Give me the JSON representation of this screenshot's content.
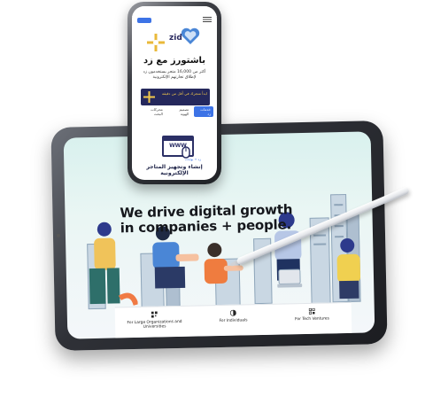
{
  "tablet": {
    "headline": [
      "We drive digital growth",
      "in companies + people."
    ],
    "cards": [
      {
        "icon": "qr-icon",
        "label": "For Large Organizations and Universities"
      },
      {
        "icon": "half-circle-icon",
        "label": "For Individuals"
      },
      {
        "icon": "grid-icon",
        "label": "For Tech Ventures"
      }
    ]
  },
  "phone": {
    "brand": "zid",
    "title": "باشتورز مع زد",
    "subtitle": "أكثر من 16,000 متجر يستخدمون زد لإطلاق تجارتهم الإلكترونية",
    "banner_text": "ابدأ متجرك في أقل من دقيقة",
    "tabs": [
      "خدمات زد",
      "تصميم الهوية",
      "محركات البحث"
    ],
    "footer_small": "زد + بوابات",
    "footer": "إنشاء وتجهيز المتاجر الإلكترونية",
    "www_label": "WWW"
  },
  "colors": {
    "accent": "#3d73e6",
    "navy": "#25285c",
    "gold": "#f1c84b",
    "mint": "#d9f1ee"
  }
}
